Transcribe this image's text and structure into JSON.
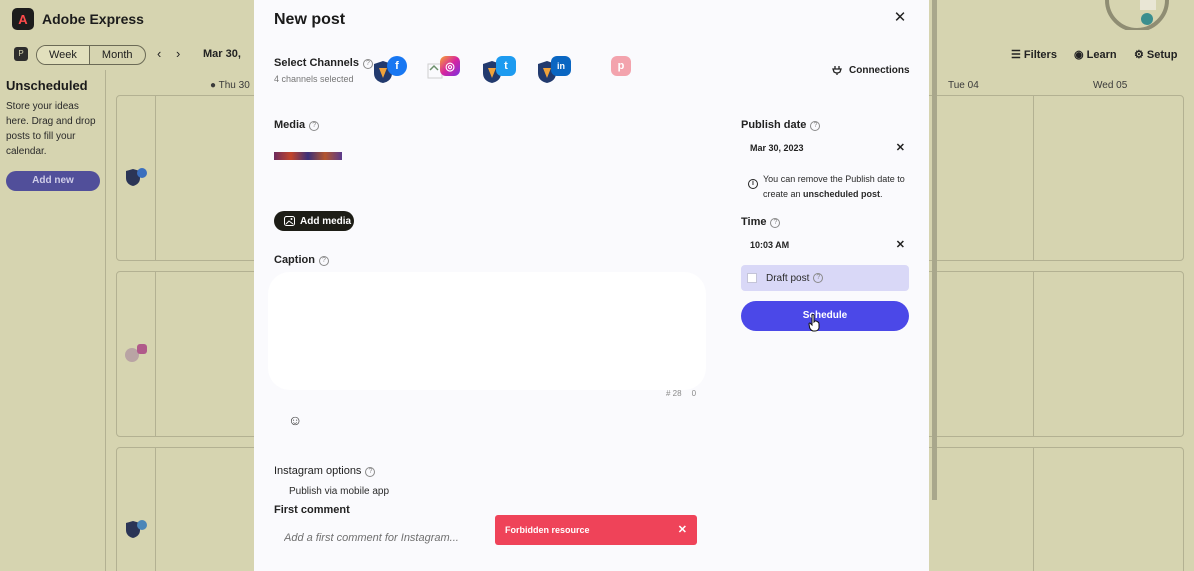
{
  "app": {
    "title": "Adobe Express",
    "logo_letter": "A",
    "view_week": "Week",
    "view_month": "Month",
    "nav_prev": "‹",
    "nav_next": "›",
    "date_range": "Mar 30,",
    "filters": "Filters",
    "learn": "Learn",
    "setup": "Setup"
  },
  "sidebar": {
    "title": "Unscheduled",
    "description": "Store your ideas here. Drag and drop posts to fill your calendar.",
    "add_new": "Add new"
  },
  "calendar": {
    "days": [
      "Thu 30",
      "Tue 04",
      "Wed 05"
    ]
  },
  "modal": {
    "title": "New post",
    "close_glyph": "✕",
    "channels": {
      "label": "Select Channels",
      "selected_count": "4 channels selected",
      "connections": "Connections",
      "items": [
        {
          "network": "facebook",
          "glyph": "f",
          "color": "#1877f2"
        },
        {
          "network": "instagram",
          "glyph": "◎",
          "color": "#d6249f"
        },
        {
          "network": "twitter",
          "glyph": "t",
          "color": "#1d9bf0"
        },
        {
          "network": "linkedin",
          "glyph": "in",
          "color": "#0a66c2"
        },
        {
          "network": "pinterest",
          "glyph": "p",
          "color": "#f3a3ad"
        }
      ]
    },
    "media": {
      "label": "Media",
      "add_media": "Add media"
    },
    "caption": {
      "label": "Caption",
      "hashtag_count": "# 28",
      "char_count": "0",
      "emoji_glyph": "☺"
    },
    "instagram_options": {
      "label": "Instagram options",
      "publish_via_mobile": "Publish via mobile app"
    },
    "first_comment": {
      "label": "First comment",
      "placeholder": "Add a first comment for Instagram..."
    },
    "publish_date": {
      "label": "Publish date",
      "value": "Mar 30, 2023",
      "info_prefix": "You can remove the Publish date to create an ",
      "info_bold": "unscheduled post",
      "info_suffix": "."
    },
    "time": {
      "label": "Time",
      "value": "10:03 AM"
    },
    "draft_post": "Draft post",
    "schedule": "Schedule",
    "clear_glyph": "✕",
    "help_glyph": "?"
  },
  "toast": {
    "message": "Forbidden resource",
    "close_glyph": "✕"
  },
  "colors": {
    "primary": "#4b48e8",
    "error": "#ef4359",
    "overlay_tint": "#d6d4b0"
  }
}
